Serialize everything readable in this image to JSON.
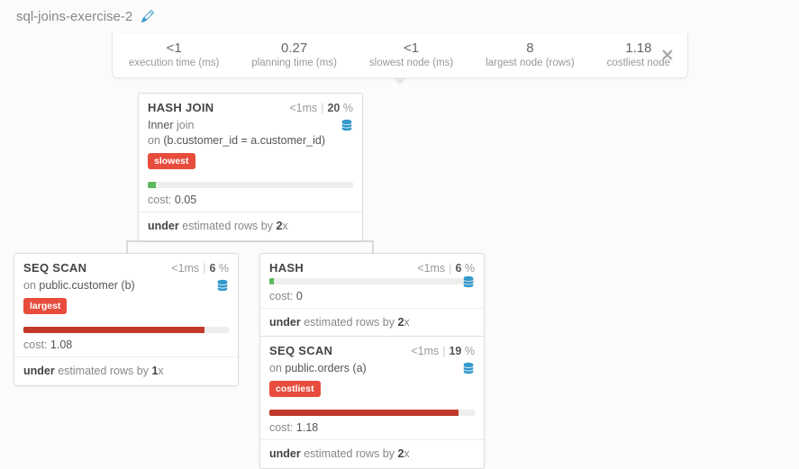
{
  "header": {
    "title": "sql-joins-exercise-2"
  },
  "stats": {
    "exec": {
      "value": "<1",
      "label": "execution time (ms)"
    },
    "plan": {
      "value": "0.27",
      "label": "planning time (ms)"
    },
    "slow": {
      "value": "<1",
      "label": "slowest node (ms)"
    },
    "large": {
      "value": "8",
      "label": "largest node (rows)"
    },
    "cost": {
      "value": "1.18",
      "label": "costliest node"
    }
  },
  "nodes": {
    "hashjoin": {
      "title": "HASH JOIN",
      "time": "<1ms",
      "pct": "20",
      "line1a": "Inner",
      "line1b": "join",
      "line2a": "on",
      "line2b": "(b.customer_id = a.customer_id)",
      "tag": "slowest",
      "cost_label": "cost:",
      "cost": "0.05",
      "est_a": "under",
      "est_b": "estimated rows by",
      "est_c": "2",
      "est_d": "x",
      "bar_pct": "4%"
    },
    "seqscan1": {
      "title": "SEQ SCAN",
      "time": "<1ms",
      "pct": "6",
      "line1a": "on",
      "line1b": "public.customer (b)",
      "tag": "largest",
      "cost_label": "cost:",
      "cost": "1.08",
      "est_a": "under",
      "est_b": "estimated rows by",
      "est_c": "1",
      "est_d": "x",
      "bar_pct": "88%"
    },
    "hash": {
      "title": "HASH",
      "time": "<1ms",
      "pct": "6",
      "cost_label": "cost:",
      "cost": "0",
      "est_a": "under",
      "est_b": "estimated rows by",
      "est_c": "2",
      "est_d": "x",
      "bar_pct": "2%"
    },
    "seqscan2": {
      "title": "SEQ SCAN",
      "time": "<1ms",
      "pct": "19",
      "line1a": "on",
      "line1b": "public.orders (a)",
      "tag": "costliest",
      "cost_label": "cost:",
      "cost": "1.18",
      "est_a": "under",
      "est_b": "estimated rows by",
      "est_c": "2",
      "est_d": "x",
      "bar_pct": "92%"
    }
  }
}
